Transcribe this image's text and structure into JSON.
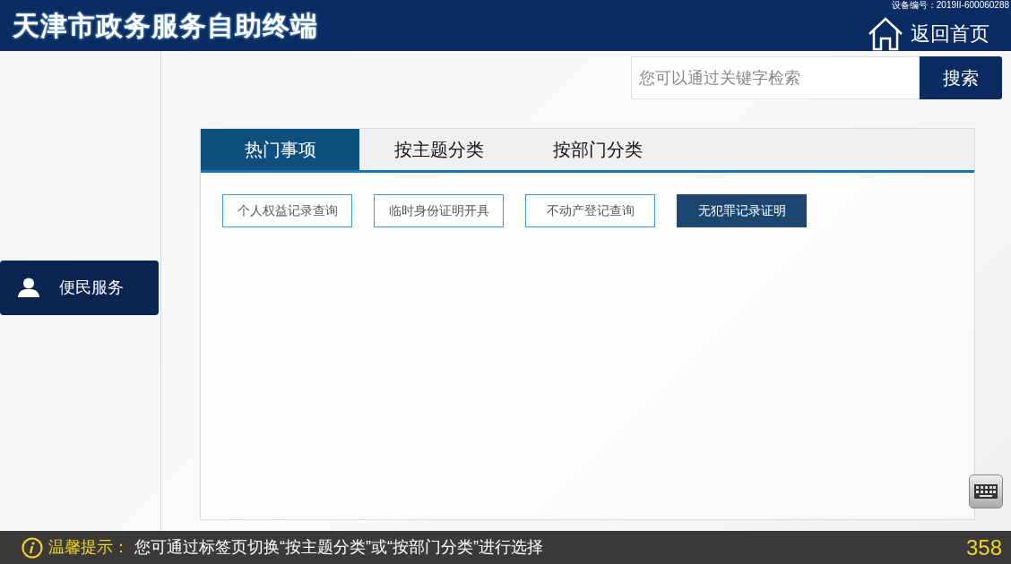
{
  "header": {
    "title": "天津市政务服务自助终端",
    "device_id": "设备编号：2019II-600060288",
    "home_link": "返回首页"
  },
  "search": {
    "placeholder": "您可以通过关键字检索",
    "button": "搜索"
  },
  "sidebar": {
    "items": [
      {
        "label": "便民服务",
        "selected": true
      }
    ]
  },
  "tabs": [
    {
      "label": "热门事项",
      "selected": true
    },
    {
      "label": "按主题分类",
      "selected": false
    },
    {
      "label": "按部门分类",
      "selected": false
    }
  ],
  "services": [
    {
      "label": "个人权益记录查询",
      "selected": false
    },
    {
      "label": "临时身份证明开具",
      "selected": false
    },
    {
      "label": "不动产登记查询",
      "selected": false
    },
    {
      "label": "无犯罪记录证明",
      "selected": true
    }
  ],
  "status_bar": {
    "tip_label": "温馨提示：",
    "tip_text": "您可通过标签页切换“按主题分类”或“按部门分类”进行选择",
    "countdown": "358"
  }
}
